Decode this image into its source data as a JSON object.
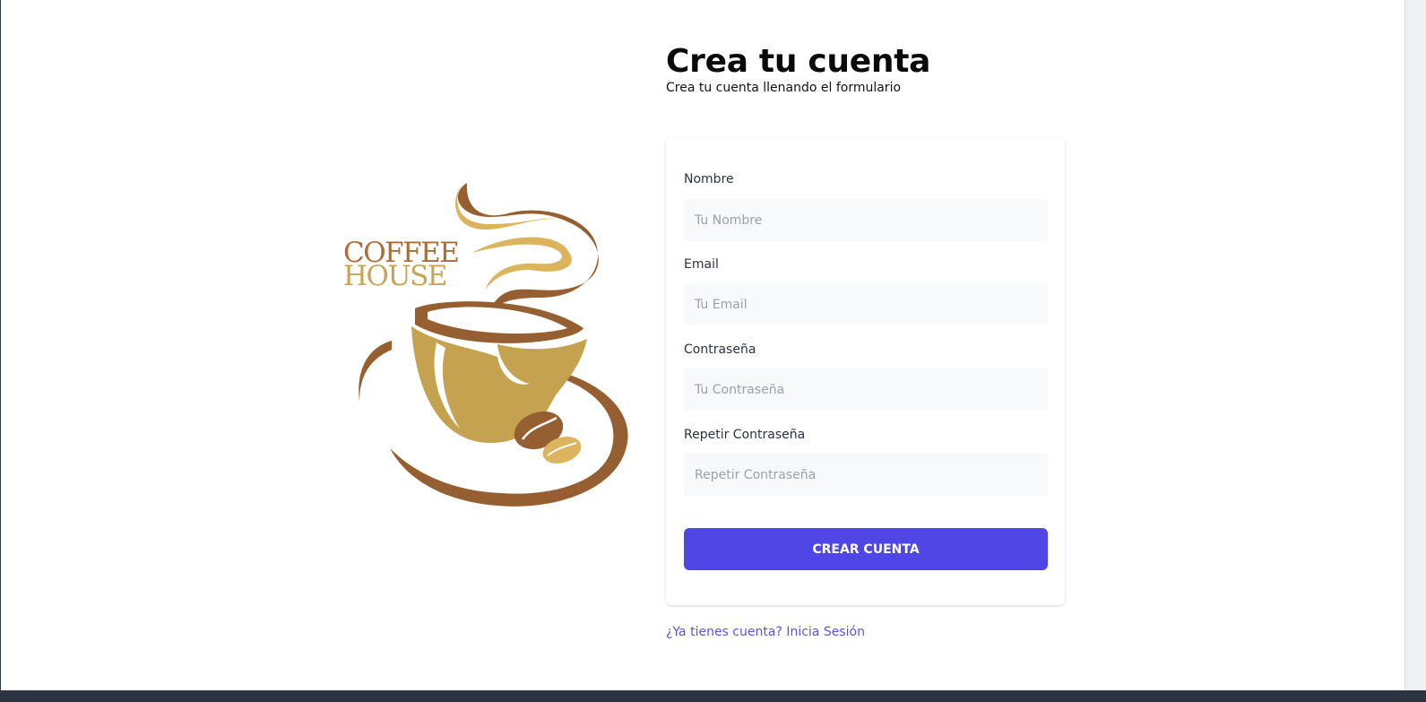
{
  "page": {
    "title": "Crea tu cuenta",
    "subtitle": "Crea tu cuenta llenando el formulario"
  },
  "logo": {
    "line1": "COFFEE",
    "line2": "HOUSE",
    "colors": {
      "brown": "#955f31",
      "gold": "#c4a24f",
      "light_gold": "#dcb45e"
    }
  },
  "form": {
    "fields": [
      {
        "label": "Nombre",
        "placeholder": "Tu Nombre",
        "value": ""
      },
      {
        "label": "Email",
        "placeholder": "Tu Email",
        "value": ""
      },
      {
        "label": "Contraseña",
        "placeholder": "Tu Contraseña",
        "value": ""
      },
      {
        "label": "Repetir Contraseña",
        "placeholder": "Repetir Contraseña",
        "value": ""
      }
    ],
    "submit_label": "CREAR CUENTA"
  },
  "links": {
    "login": "¿Ya tienes cuenta? Inicia Sesión"
  },
  "colors": {
    "accent": "#4f46e5",
    "link": "#5b55d6",
    "input_bg": "#f8f9fb"
  }
}
